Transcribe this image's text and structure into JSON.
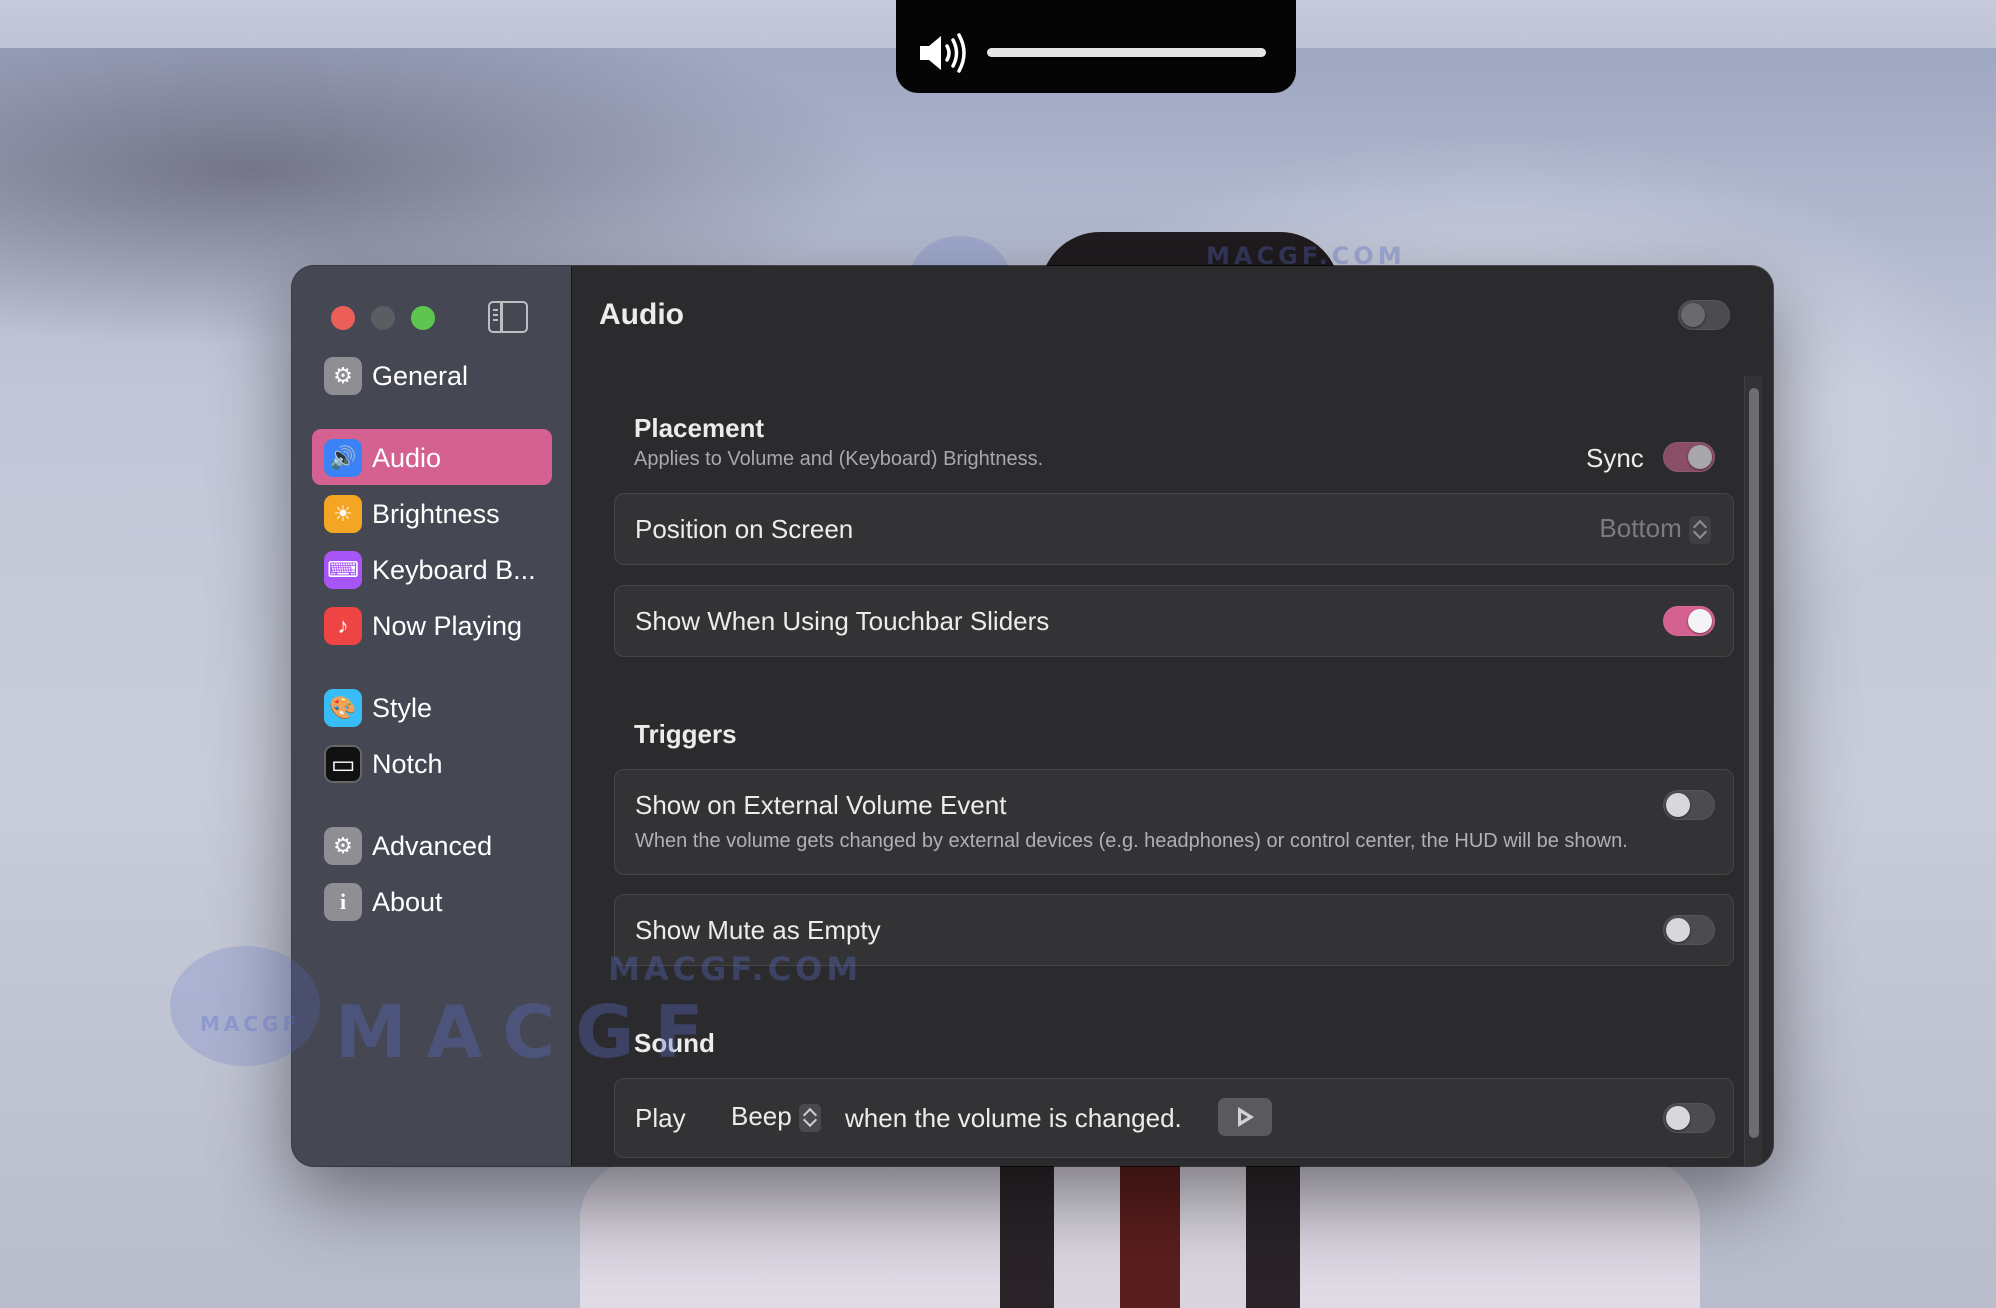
{
  "hud": {
    "icon": "speaker-volume-icon",
    "level": 1.0
  },
  "watermark": {
    "text_main": "MACGF",
    "text_url": "MACGF.COM",
    "cat_label": "MACGF"
  },
  "window": {
    "title": "Audio",
    "header_toggle_on": false
  },
  "sidebar": {
    "items": [
      {
        "label": "General",
        "icon": "gear-icon",
        "color": "#8e8e93",
        "active": false
      },
      {
        "label": "Audio",
        "icon": "speaker-icon",
        "color": "#3b82f6",
        "active": true
      },
      {
        "label": "Brightness",
        "icon": "sun-icon",
        "color": "#f5a524",
        "active": false
      },
      {
        "label": "Keyboard B...",
        "icon": "keyboard-icon",
        "color": "#a855f7",
        "active": false
      },
      {
        "label": "Now Playing",
        "icon": "music-note-icon",
        "color": "#ef4444",
        "active": false
      },
      {
        "label": "Style",
        "icon": "palette-icon",
        "color": "#38bdf8",
        "active": false
      },
      {
        "label": "Notch",
        "icon": "display-icon",
        "color": "#111111",
        "active": false
      },
      {
        "label": "Advanced",
        "icon": "gears-icon",
        "color": "#8e8e93",
        "active": false
      },
      {
        "label": "About",
        "icon": "info-icon",
        "color": "#8e8e93",
        "active": false
      }
    ]
  },
  "placement": {
    "title": "Placement",
    "subtitle": "Applies to Volume and (Keyboard) Brightness.",
    "sync_label": "Sync",
    "sync_on": true,
    "position_label": "Position on Screen",
    "position_value": "Bottom",
    "touchbar_label": "Show When Using Touchbar Sliders",
    "touchbar_on": true
  },
  "triggers": {
    "title": "Triggers",
    "external_label": "Show on External Volume Event",
    "external_desc": "When the volume gets changed by external devices (e.g. headphones) or control center, the HUD will be shown.",
    "external_on": false,
    "mute_label": "Show Mute as Empty",
    "mute_on": false
  },
  "sound": {
    "title": "Sound",
    "play_label": "Play",
    "sound_value": "Beep",
    "suffix": "when the volume is changed.",
    "enabled": false
  },
  "colors": {
    "accent": "#d4618f"
  }
}
